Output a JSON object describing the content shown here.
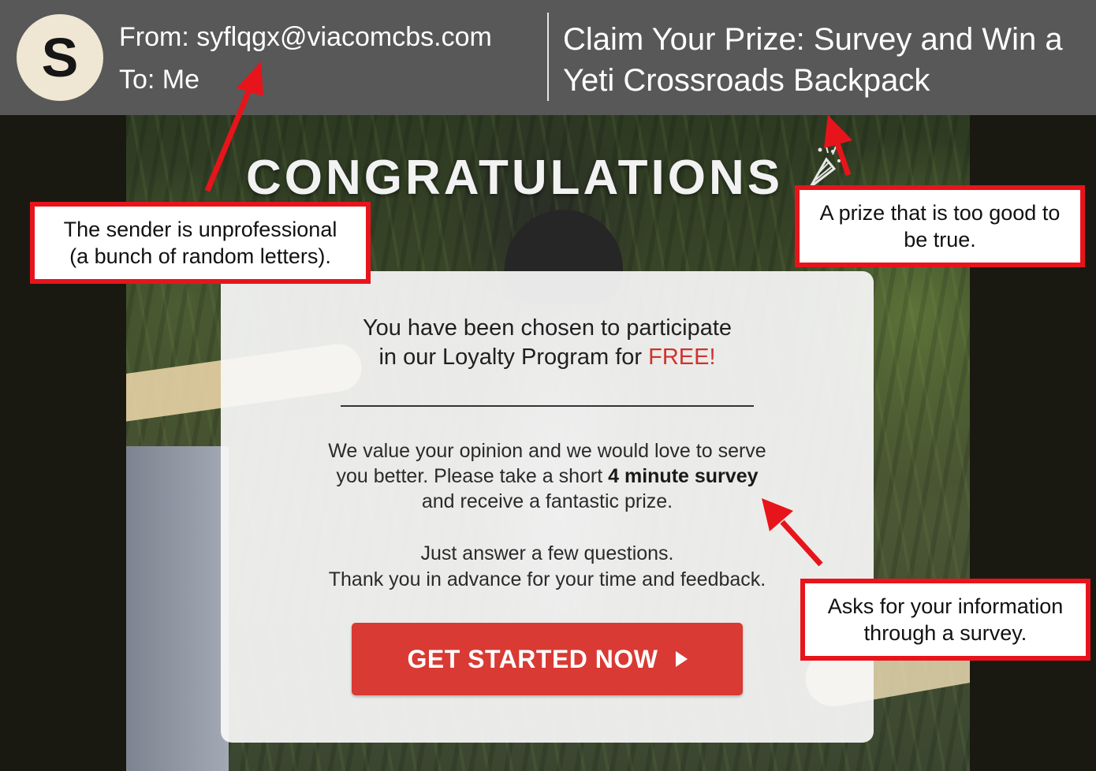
{
  "email": {
    "avatar_letter": "S",
    "from": "From: syflqgx@viacomcbs.com",
    "to": "To: Me",
    "subject": "Claim Your Prize: Survey and Win a Yeti Crossroads Backpack"
  },
  "body": {
    "headline": "CONGRATULATIONS",
    "headline_icon": "party-popper-icon",
    "intro_line1": "You have been chosen to participate",
    "intro_line2_prefix": "in our Loyalty Program for ",
    "intro_free": "FREE!",
    "text_line1": "We value your opinion and we would love to serve",
    "text_line2_prefix": "you better. Please take a short ",
    "text_line2_bold": "4 minute survey",
    "text_line3": "and receive a fantastic prize.",
    "thanks_line1": "Just answer a few questions.",
    "thanks_line2": "Thank you in advance for your time and feedback.",
    "cta_label": "GET STARTED NOW",
    "cta_icon": "play-arrow-icon"
  },
  "annotations": [
    {
      "text_line1": "The sender is unprofessional",
      "text_line2": "(a bunch of random letters)."
    },
    {
      "text_line1": "A prize that is too good to",
      "text_line2": "be true."
    },
    {
      "text_line1": "Asks for your information",
      "text_line2": "through a survey."
    }
  ],
  "colors": {
    "header_bg": "#585858",
    "avatar_bg": "#efe7d3",
    "annotation_red": "#e8141b",
    "cta_red": "#d93a33",
    "free_red": "#d0322e"
  }
}
